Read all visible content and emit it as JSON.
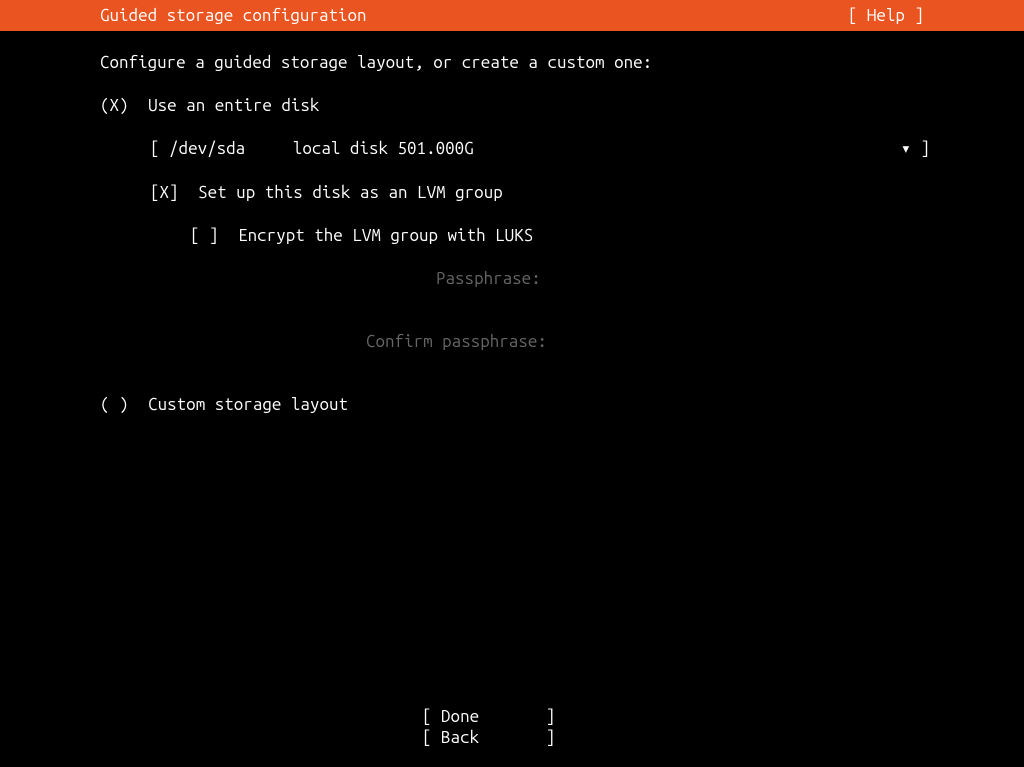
{
  "header": {
    "title": "Guided storage configuration",
    "help": "[ Help ]"
  },
  "instruction": "Configure a guided storage layout, or create a custom one:",
  "options": {
    "use_entire_disk": {
      "mark": "(X)",
      "label": "Use an entire disk"
    },
    "disk_select": {
      "left": "[ /dev/sda     local disk 501.000G",
      "right": "▾ ]"
    },
    "lvm": {
      "mark": "[X]",
      "label": "Set up this disk as an LVM group"
    },
    "encrypt": {
      "mark": "[ ]",
      "label": "Encrypt the LVM group with LUKS"
    },
    "passphrase_label": "Passphrase:",
    "confirm_label": "Confirm passphrase:",
    "custom": {
      "mark": "( )",
      "label": "Custom storage layout"
    }
  },
  "footer": {
    "done": "[ Done       ]",
    "back": "[ Back       ]"
  }
}
